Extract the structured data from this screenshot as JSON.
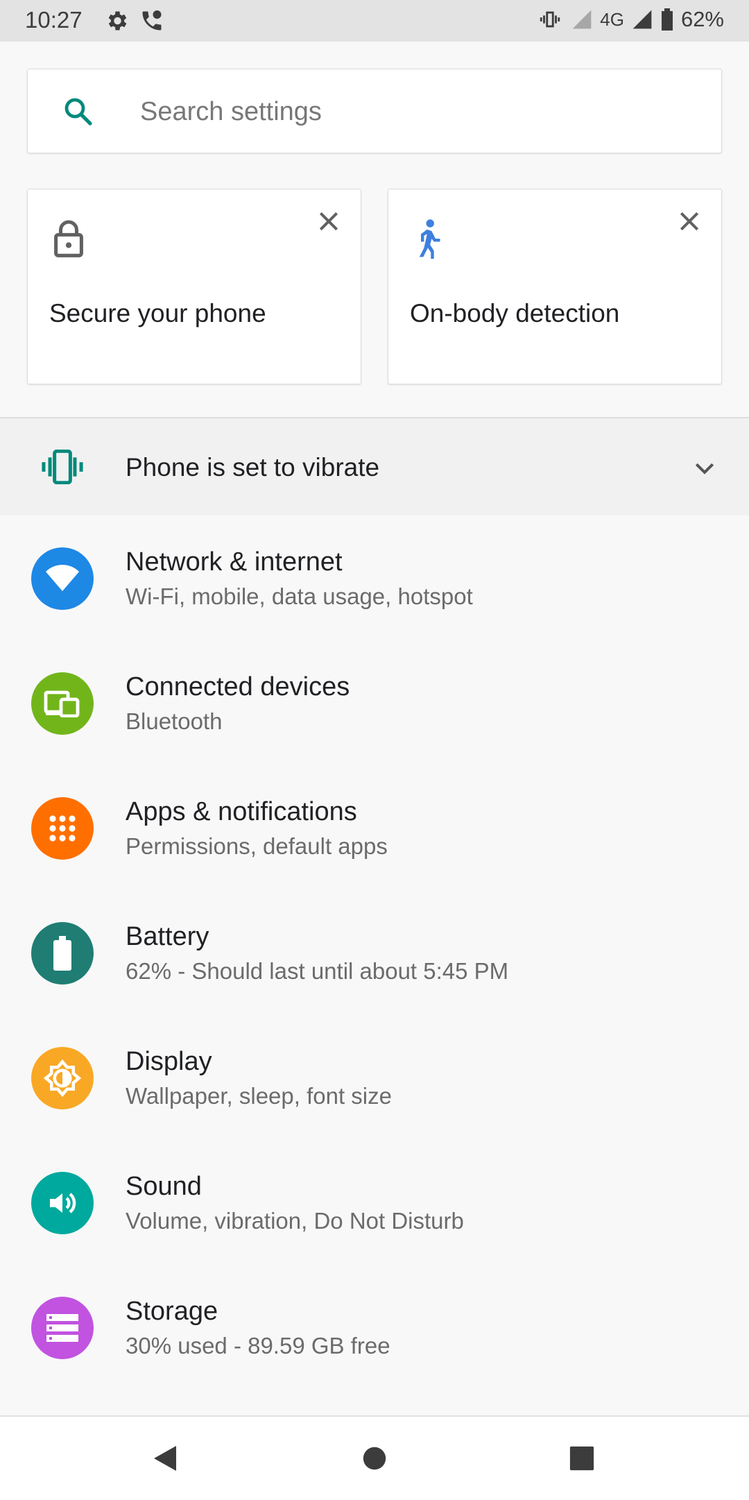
{
  "status_bar": {
    "time": "10:27",
    "network": "4G",
    "battery": "62%",
    "icons": [
      "gear-icon",
      "wifi-calling-icon",
      "vibrate-icon",
      "signal-icon",
      "battery-icon"
    ]
  },
  "search": {
    "placeholder": "Search settings",
    "icon": "search-icon"
  },
  "suggestions": [
    {
      "title": "Secure your phone",
      "icon": "lock-icon"
    },
    {
      "title": "On-body detection",
      "icon": "walking-person-icon"
    }
  ],
  "condition": {
    "text": "Phone is set to vibrate",
    "icon": "vibrate-icon",
    "accent": "#00897b"
  },
  "settings": [
    {
      "title": "Network & internet",
      "subtitle": "Wi-Fi, mobile, data usage, hotspot",
      "icon": "wifi-icon",
      "color": "#1e88e5"
    },
    {
      "title": "Connected devices",
      "subtitle": "Bluetooth",
      "icon": "devices-icon",
      "color": "#72b51b"
    },
    {
      "title": "Apps & notifications",
      "subtitle": "Permissions, default apps",
      "icon": "apps-grid-icon",
      "color": "#ff6f00"
    },
    {
      "title": "Battery",
      "subtitle": "62% - Should last until about 5:45 PM",
      "icon": "battery-icon",
      "color": "#1f7d73"
    },
    {
      "title": "Display",
      "subtitle": "Wallpaper, sleep, font size",
      "icon": "brightness-icon",
      "color": "#f9a825"
    },
    {
      "title": "Sound",
      "subtitle": "Volume, vibration, Do Not Disturb",
      "icon": "speaker-icon",
      "color": "#00a99d"
    },
    {
      "title": "Storage",
      "subtitle": "30% used - 89.59 GB free",
      "icon": "storage-icon",
      "color": "#c153e0"
    }
  ],
  "nav": {
    "icons": [
      "back-icon",
      "home-icon",
      "recents-icon"
    ]
  }
}
